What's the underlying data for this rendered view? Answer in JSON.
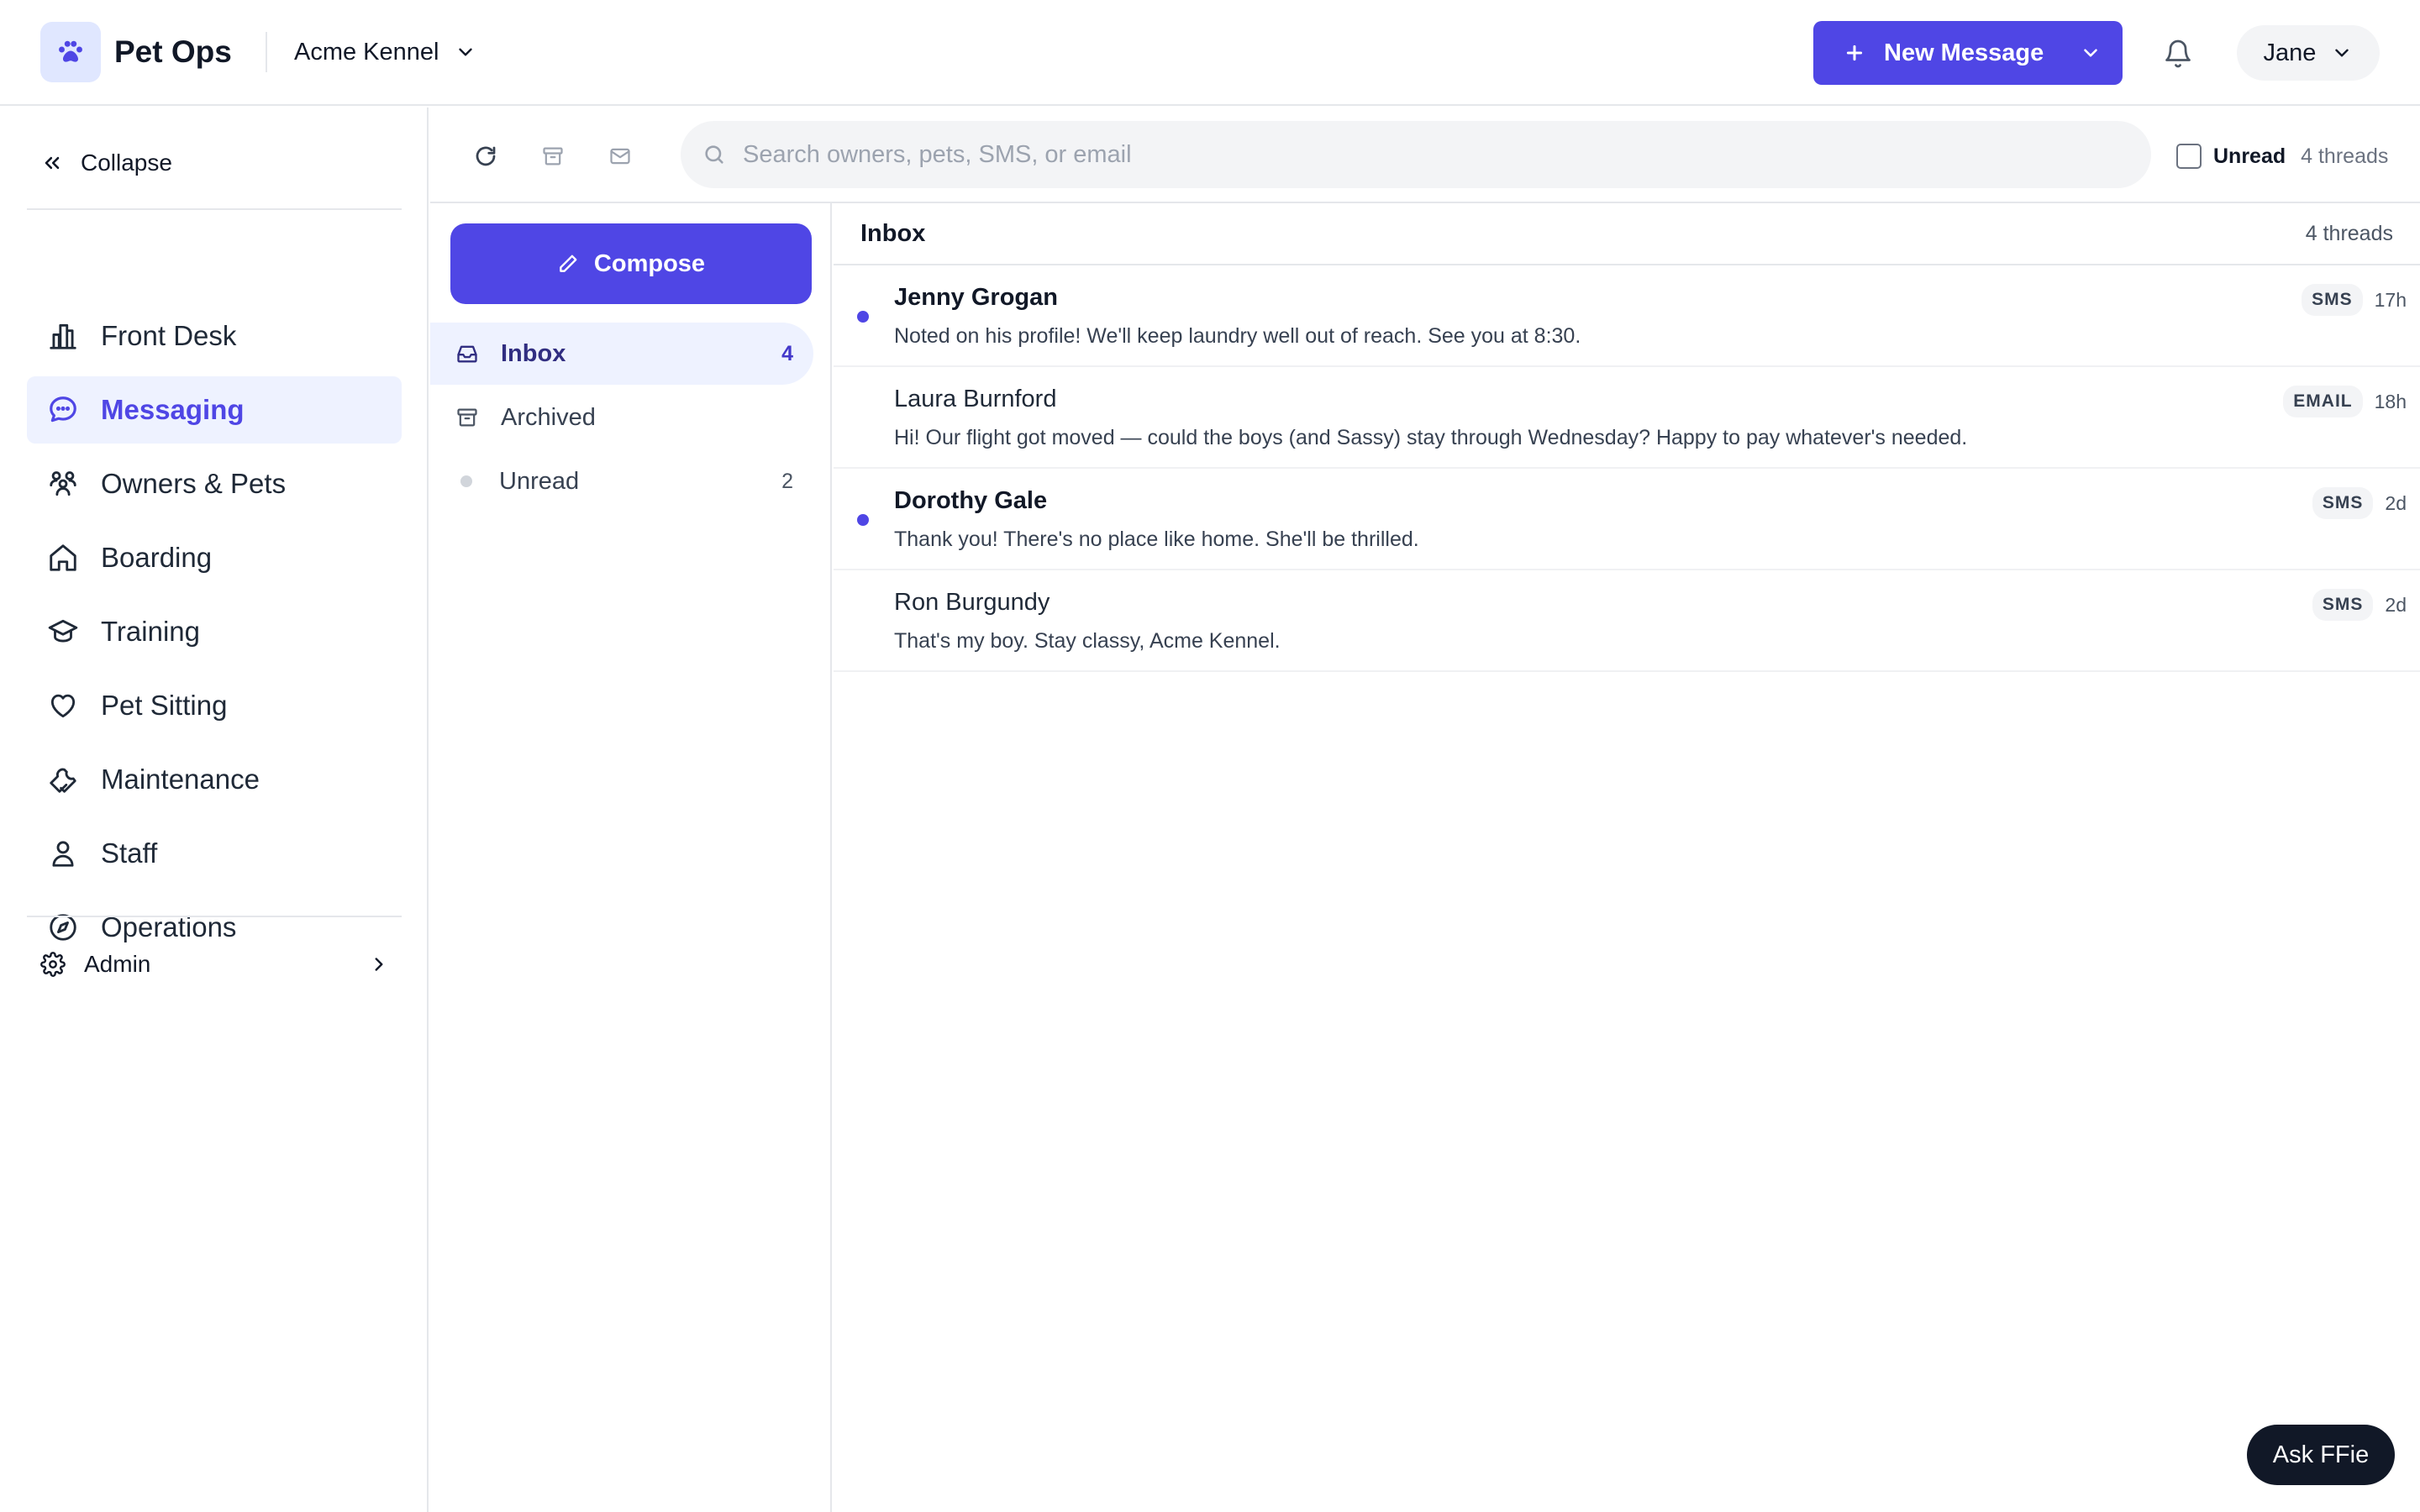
{
  "app": {
    "brand": "Pet Ops",
    "org_name": "Acme Kennel",
    "new_message_label": "New Message",
    "user_name": "Jane",
    "accent_color": "#4f46e5"
  },
  "sidebar": {
    "collapse_label": "Collapse",
    "items": [
      {
        "label": "Front Desk",
        "icon": "building-icon",
        "active": false
      },
      {
        "label": "Messaging",
        "icon": "chat-bubble-icon",
        "active": true
      },
      {
        "label": "Owners & Pets",
        "icon": "people-icon",
        "active": false
      },
      {
        "label": "Boarding",
        "icon": "home-icon",
        "active": false
      },
      {
        "label": "Training",
        "icon": "graduation-cap-icon",
        "active": false
      },
      {
        "label": "Pet Sitting",
        "icon": "heart-icon",
        "active": false
      },
      {
        "label": "Maintenance",
        "icon": "wrench-icon",
        "active": false
      },
      {
        "label": "Staff",
        "icon": "person-icon",
        "active": false
      },
      {
        "label": "Operations",
        "icon": "compass-icon",
        "active": false
      }
    ],
    "admin_label": "Admin"
  },
  "toolbar": {
    "search_placeholder": "Search owners, pets, SMS, or email",
    "unread_filter_label": "Unread",
    "thread_count_label": "4 threads"
  },
  "folders": {
    "compose_label": "Compose",
    "items": [
      {
        "label": "Inbox",
        "count": "4",
        "active": true
      },
      {
        "label": "Archived",
        "count": "",
        "active": false
      },
      {
        "label": "Unread",
        "count": "2",
        "active": false
      }
    ]
  },
  "threads": {
    "title": "Inbox",
    "count_label": "4 threads",
    "items": [
      {
        "name": "Jenny Grogan",
        "preview": "Noted on his profile! We'll keep laundry well out of reach. See you at 8:30.",
        "channel": "SMS",
        "time": "17h",
        "unread": true
      },
      {
        "name": "Laura Burnford",
        "preview": "Hi! Our flight got moved — could the boys (and Sassy) stay through Wednesday? Happy to pay whatever's needed.",
        "channel": "EMAIL",
        "time": "18h",
        "unread": false
      },
      {
        "name": "Dorothy Gale",
        "preview": "Thank you! There's no place like home. She'll be thrilled.",
        "channel": "SMS",
        "time": "2d",
        "unread": true
      },
      {
        "name": "Ron Burgundy",
        "preview": "That's my boy. Stay classy, Acme Kennel.",
        "channel": "SMS",
        "time": "2d",
        "unread": false
      }
    ]
  },
  "assistant": {
    "button_label": "Ask FFie"
  }
}
